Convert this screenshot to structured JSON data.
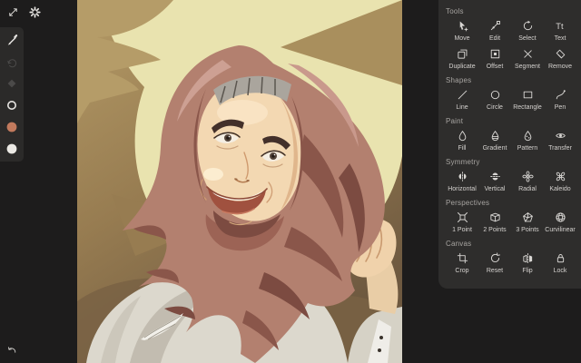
{
  "left_toolbar": {
    "top_items": [
      {
        "name": "collapse",
        "icon": "collapse"
      },
      {
        "name": "settings",
        "icon": "gear"
      }
    ],
    "tools": [
      {
        "name": "brush",
        "icon": "brush",
        "enabled": true
      },
      {
        "name": "redo",
        "icon": "redo",
        "enabled": false
      },
      {
        "name": "eraser",
        "icon": "eraser",
        "enabled": false
      },
      {
        "name": "stroke-width",
        "icon": "ring",
        "enabled": true
      },
      {
        "name": "color-primary",
        "icon": "swatch",
        "color": "#c27a5d"
      },
      {
        "name": "color-secondary",
        "icon": "swatch",
        "color": "#ebe9e4"
      }
    ],
    "undo": {
      "name": "undo",
      "icon": "undo"
    }
  },
  "right_panel": {
    "sections": [
      {
        "title": "Tools",
        "items": [
          {
            "label": "Move",
            "icon": "move"
          },
          {
            "label": "Edit",
            "icon": "edit"
          },
          {
            "label": "Select",
            "icon": "select"
          },
          {
            "label": "Text",
            "icon": "text"
          },
          {
            "label": "Duplicate",
            "icon": "duplicate"
          },
          {
            "label": "Offset",
            "icon": "offset"
          },
          {
            "label": "Segment",
            "icon": "segment"
          },
          {
            "label": "Remove",
            "icon": "remove"
          }
        ]
      },
      {
        "title": "Shapes",
        "items": [
          {
            "label": "Line",
            "icon": "line"
          },
          {
            "label": "Circle",
            "icon": "circle"
          },
          {
            "label": "Rectangle",
            "icon": "rectangle"
          },
          {
            "label": "Pen",
            "icon": "pen"
          }
        ]
      },
      {
        "title": "Paint",
        "items": [
          {
            "label": "Fill",
            "icon": "fill"
          },
          {
            "label": "Gradient",
            "icon": "gradient"
          },
          {
            "label": "Pattern",
            "icon": "pattern"
          },
          {
            "label": "Transfer",
            "icon": "transfer"
          }
        ]
      },
      {
        "title": "Symmetry",
        "items": [
          {
            "label": "Horizontal",
            "icon": "sym_h"
          },
          {
            "label": "Vertical",
            "icon": "sym_v"
          },
          {
            "label": "Radial",
            "icon": "radial"
          },
          {
            "label": "Kaleido",
            "icon": "kaleido"
          }
        ]
      },
      {
        "title": "Perspectives",
        "items": [
          {
            "label": "1 Point",
            "icon": "p1"
          },
          {
            "label": "2 Points",
            "icon": "p2"
          },
          {
            "label": "3 Points",
            "icon": "p3"
          },
          {
            "label": "Curvilinear",
            "icon": "curvi"
          }
        ]
      },
      {
        "title": "Canvas",
        "items": [
          {
            "label": "Crop",
            "icon": "crop"
          },
          {
            "label": "Reset",
            "icon": "reset"
          },
          {
            "label": "Flip",
            "icon": "flip"
          },
          {
            "label": "Lock",
            "icon": "lock"
          }
        ]
      }
    ]
  },
  "artwork_colors": {
    "background_tan": "#a08454",
    "splash_cream": "#e9e3af",
    "hijab": "#b3806f",
    "hijab_shadow": "#8a564a",
    "skin": "#f3d8b2",
    "garment": "#dcd8cd"
  },
  "ui_colors": {
    "app_background": "#1d1c1c",
    "panel_background": "#2e2d2c",
    "strip_background": "#2b2a29",
    "label_text": "#d4d1ce",
    "section_text": "#a7a4a1"
  }
}
